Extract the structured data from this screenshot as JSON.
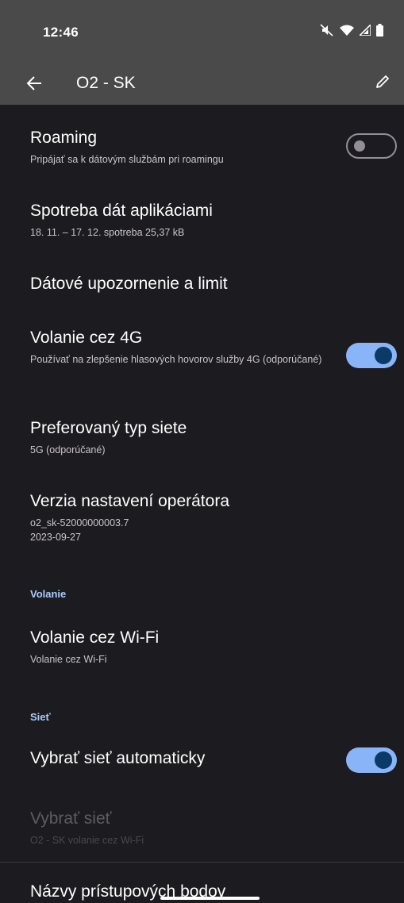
{
  "status_bar": {
    "time": "12:46",
    "icons": [
      "mute-icon",
      "wifi-icon",
      "signal-icon",
      "battery-icon"
    ]
  },
  "app_bar": {
    "title": "O2 - SK",
    "back_icon": "arrow-back-icon",
    "edit_icon": "pencil-icon"
  },
  "settings": {
    "roaming": {
      "title": "Roaming",
      "subtitle": "Pripájať sa k dátovým službám pri roamingu",
      "enabled": false
    },
    "app_data_usage": {
      "title": "Spotreba dát aplikáciami",
      "subtitle": "18. 11. – 17. 12. spotreba 25,37 kB"
    },
    "data_warning": {
      "title": "Dátové upozornenie a limit"
    },
    "volte": {
      "title": "Volanie cez 4G",
      "subtitle": "Používať na zlepšenie hlasových hovorov služby 4G (odporúčané)",
      "enabled": true
    },
    "network_type": {
      "title": "Preferovaný typ siete",
      "subtitle": "5G (odporúčané)"
    },
    "carrier_version": {
      "title": "Verzia nastavení operátora",
      "subtitle_line1": "o2_sk-52000000003.7",
      "subtitle_line2": "2023-09-27"
    },
    "section_calling": "Volanie",
    "wifi_calling": {
      "title": "Volanie cez Wi-Fi",
      "subtitle": "Volanie cez Wi-Fi"
    },
    "section_network": "Sieť",
    "auto_network": {
      "title": "Vybrať sieť automaticky",
      "enabled": true
    },
    "choose_network": {
      "title": "Vybrať sieť",
      "subtitle": "O2 - SK volanie cez Wi-Fi",
      "disabled": true
    },
    "apn": {
      "title": "Názvy prístupových bodov"
    }
  },
  "colors": {
    "background": "#1c1b1f",
    "app_bar": "#4a4a4a",
    "accent": "#8ab4f8",
    "section_header": "#aacbff"
  }
}
